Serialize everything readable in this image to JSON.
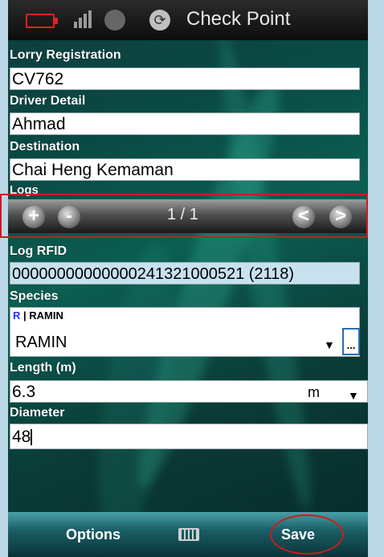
{
  "titlebar": {
    "title": "Check Point"
  },
  "lorry": {
    "label": "Lorry Registration",
    "value": "CV762"
  },
  "driver": {
    "label": "Driver Detail",
    "value": "Ahmad"
  },
  "destination": {
    "label": "Destination",
    "value": "Chai Heng Kemaman"
  },
  "logs": {
    "label": "Logs",
    "add_glyph": "+",
    "remove_glyph": "-",
    "counter": "1 / 1",
    "prev_glyph": "<",
    "next_glyph": ">"
  },
  "log_rfid": {
    "label": "Log RFID",
    "value": "00000000000000241321000521 (2118)"
  },
  "species": {
    "label": "Species",
    "code": "R",
    "separator": " | ",
    "name_small": "RAMIN",
    "selected": "RAMIN",
    "browse_label": "..."
  },
  "length": {
    "label": "Length (m)",
    "value": "6.3",
    "unit": "m"
  },
  "diameter": {
    "label": "Diameter",
    "value": "48"
  },
  "menu": {
    "left": "Options",
    "right": "Save"
  },
  "colors": {
    "highlight": "#c81e1e",
    "rfid_bg": "#c8e1ef",
    "species_code": "#2030ff"
  }
}
